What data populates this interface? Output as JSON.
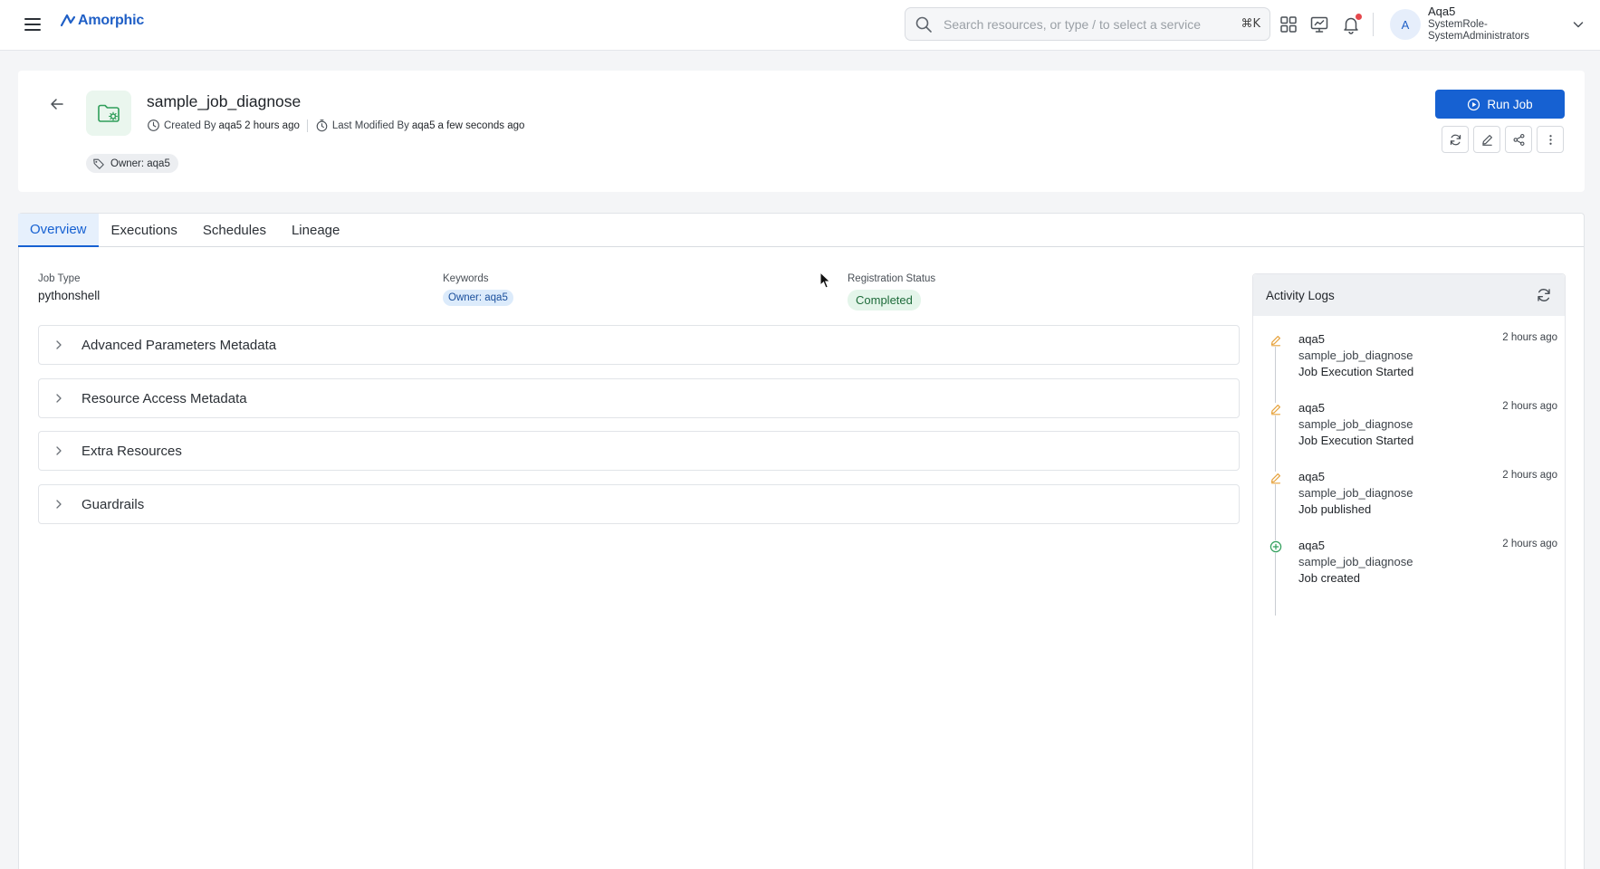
{
  "app": {
    "name": "Amorphic",
    "brand_color": "#1f5fc6"
  },
  "search": {
    "placeholder": "Search resources, or type / to select a service",
    "shortcut": "⌘K"
  },
  "user": {
    "initial": "A",
    "name": "Aqa5",
    "role": "SystemRole-SystemAdministrators"
  },
  "job": {
    "name": "sample_job_diagnose",
    "created_by_label": "Created By",
    "created_by": "aqa5",
    "created_ago": "2 hours ago",
    "modified_by_label": "Last Modified By",
    "modified_by": "aqa5",
    "modified_ago": "a few seconds ago",
    "owner_tag": "Owner: aqa5",
    "run_label": "Run Job"
  },
  "tabs": [
    {
      "label": "Overview",
      "active": true
    },
    {
      "label": "Executions",
      "active": false
    },
    {
      "label": "Schedules",
      "active": false
    },
    {
      "label": "Lineage",
      "active": false
    }
  ],
  "overview": {
    "job_type_label": "Job Type",
    "job_type": "pythonshell",
    "keywords_label": "Keywords",
    "keyword": "Owner: aqa5",
    "registration_status_label": "Registration Status",
    "registration_status": "Completed",
    "sections": [
      "Advanced Parameters Metadata",
      "Resource Access Metadata",
      "Extra Resources",
      "Guardrails"
    ]
  },
  "activity_logs": {
    "title": "Activity Logs",
    "items": [
      {
        "icon": "pencil-icon",
        "user": "aqa5",
        "resource": "sample_job_diagnose",
        "message": "Job Execution Started",
        "time": "2 hours ago"
      },
      {
        "icon": "pencil-icon",
        "user": "aqa5",
        "resource": "sample_job_diagnose",
        "message": "Job Execution Started",
        "time": "2 hours ago"
      },
      {
        "icon": "pencil-icon",
        "user": "aqa5",
        "resource": "sample_job_diagnose",
        "message": "Job published",
        "time": "2 hours ago"
      },
      {
        "icon": "plus-circle-icon",
        "user": "aqa5",
        "resource": "sample_job_diagnose",
        "message": "Job created",
        "time": "2 hours ago"
      }
    ]
  },
  "colors": {
    "primary": "#1661d2",
    "success_bg": "#e4f5ea",
    "success_text": "#1e6b3a",
    "edit_icon": "#e6a23c",
    "create_icon": "#2f9e5a"
  }
}
